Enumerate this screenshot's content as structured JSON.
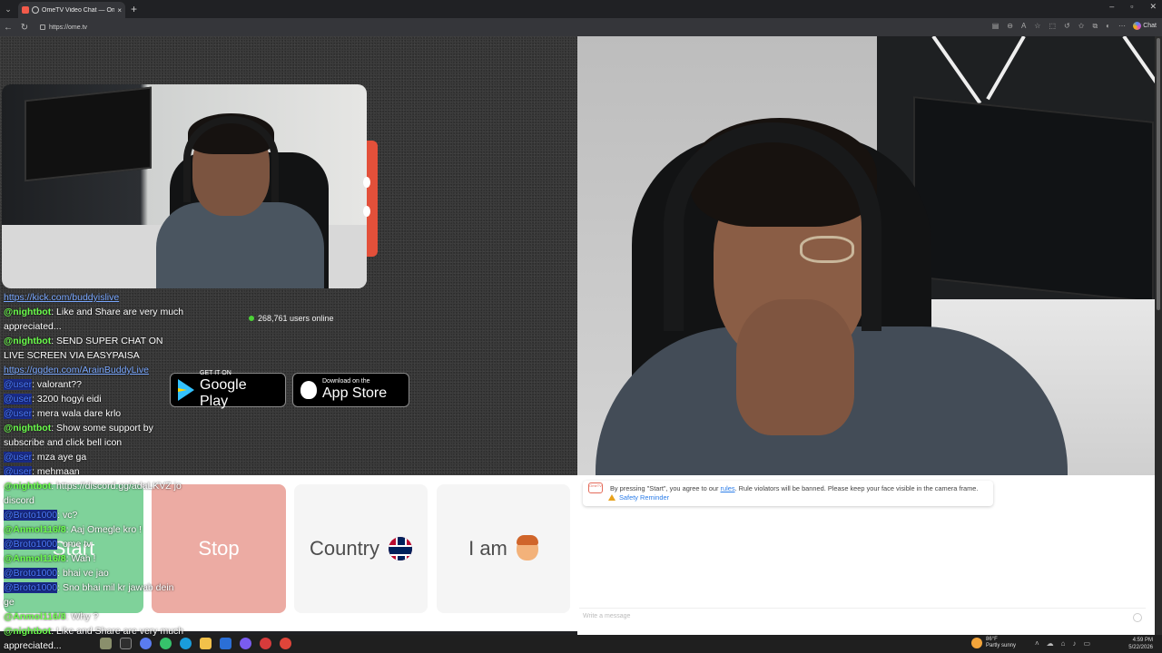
{
  "browser": {
    "tab_title": "OmeTV Video Chat — Omeg",
    "tab_close": "×",
    "new_tab": "+",
    "url": "https://ome.tv",
    "chat_label": "Chat",
    "win_min": "–",
    "win_max": "▫",
    "win_close": "✕"
  },
  "stream_chat_top": [
    {
      "user": "",
      "text": "https://kick.com/buddyislive",
      "type": "link"
    },
    {
      "user": "@nightbot",
      "text": ": Like and Share are very much appreciated...",
      "type": "bot"
    },
    {
      "user": "@nightbot",
      "text": ": SEND SUPER CHAT ON LIVE SCREEN VIA EASYPAISA",
      "type": "bot"
    },
    {
      "user": "",
      "text": "https://ggden.com/ArainBuddyLive",
      "type": "link"
    },
    {
      "user": "@user",
      "text": ": valorant??",
      "type": "user"
    },
    {
      "user": "@user",
      "text": ": 3200 hogyi eidi",
      "type": "user"
    },
    {
      "user": "@user",
      "text": ": mera wala dare krlo",
      "type": "user"
    },
    {
      "user": "@nightbot",
      "text": ": Show some support by subscribe and click bell icon",
      "type": "bot"
    },
    {
      "user": "@user",
      "text": ": mza aye ga",
      "type": "user"
    },
    {
      "user": "@user",
      "text": ": mehmaan",
      "type": "user"
    }
  ],
  "stream_chat_bottom": [
    {
      "user": "@nightbot",
      "text": ": https://discord.gg/adaLKVZ jo discord",
      "type": "bot"
    },
    {
      "user": "@Broto1000",
      "text": ": vc?",
      "type": "user"
    },
    {
      "user": "@Anmol116/8",
      "text": ": Aaj Omegle kro !",
      "type": "bot"
    },
    {
      "user": "@Broto1000",
      "text": ": ome tv",
      "type": "user"
    },
    {
      "user": "@Anmol116/8",
      "text": ": Wah !",
      "type": "bot"
    },
    {
      "user": "@Broto1000",
      "text": ": bhai ve jao",
      "type": "user"
    },
    {
      "user": "@Broto1000",
      "text": ": Sno bhai mil kr jawab dein ge",
      "type": "user"
    },
    {
      "user": "@Anmol116/8",
      "text": ": Why ?",
      "type": "bot"
    },
    {
      "user": "@nightbot",
      "text": ": Like and Share are very much appreciated...",
      "type": "bot"
    }
  ],
  "online": {
    "count_text": "268,761 users online"
  },
  "store": {
    "google_small": "GET IT ON",
    "google_big": "Google Play",
    "apple_small": "Download on the",
    "apple_big": "App Store"
  },
  "controls": {
    "start": "Start",
    "stop": "Stop",
    "country": "Country",
    "iam": "I am"
  },
  "notice": {
    "logo_text": "OmeTV",
    "text_before": "By pressing \"Start\", you agree to our ",
    "rules_link": "rules",
    "text_after": ". Rule violators will be banned. Please keep your face visible in the camera frame.",
    "safety_link": "Safety Reminder"
  },
  "message": {
    "placeholder": "Write a message"
  },
  "taskbar": {
    "weather_temp": "86°F",
    "weather_desc": "Partly sunny",
    "time": "4:59 PM",
    "date": "5/22/2026"
  },
  "colors": {
    "start": "#7fd29a",
    "stop": "#ecaba3",
    "online_dot": "#4cd137",
    "accent_link": "#2b7de9"
  }
}
